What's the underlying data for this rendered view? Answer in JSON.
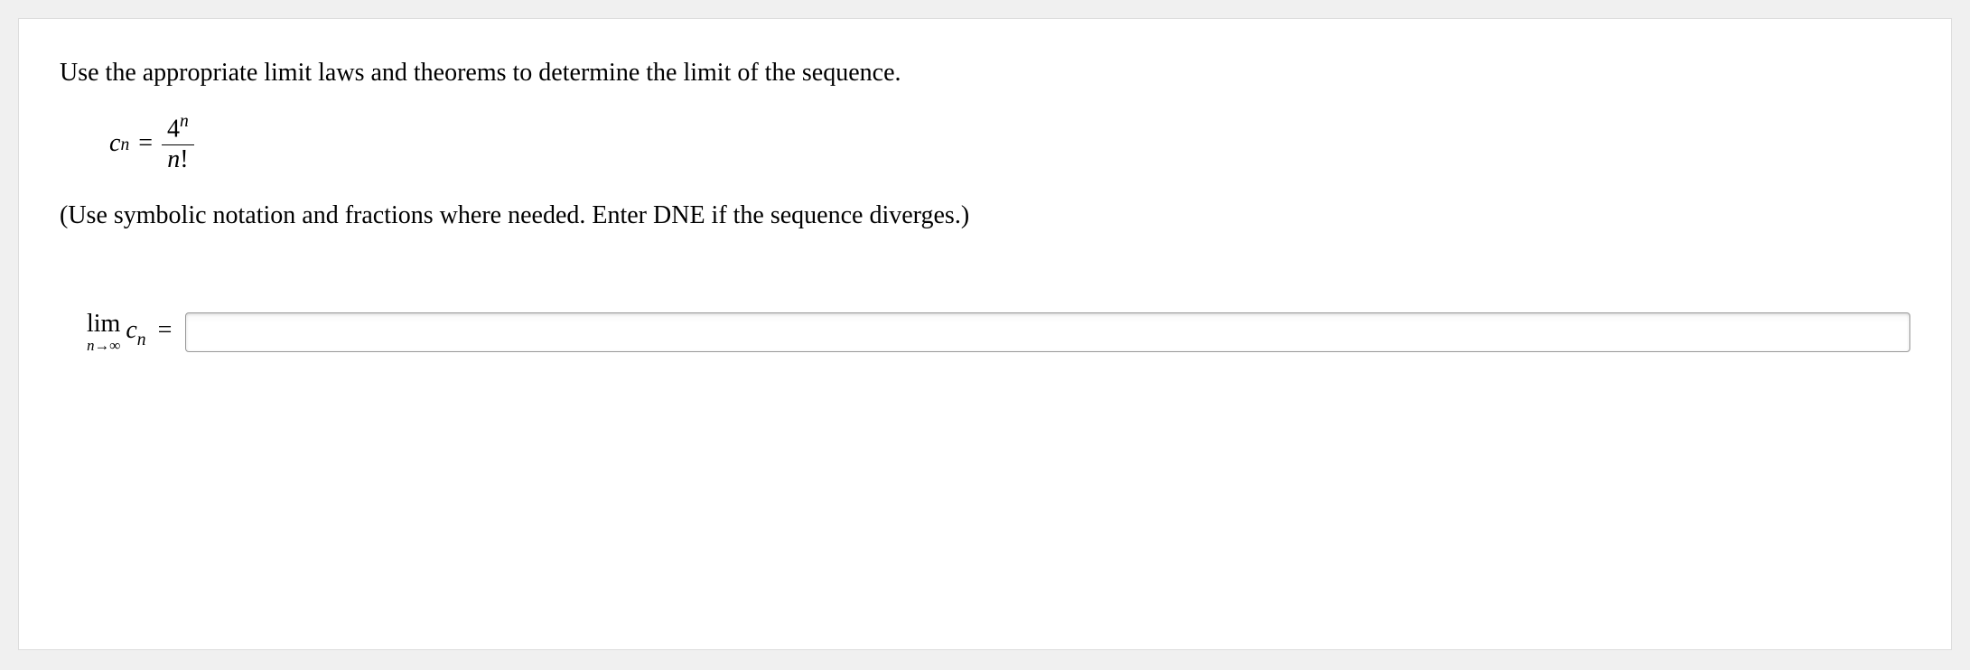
{
  "prompt": "Use the appropriate limit laws and theorems to determine the limit of the sequence.",
  "formula": {
    "lhs_var": "c",
    "lhs_sub": "n",
    "eq": "=",
    "num_base": "4",
    "num_exp": "n",
    "den_var": "n",
    "den_op": "!"
  },
  "hint": "(Use symbolic notation and fractions where needed. Enter DNE if the sequence diverges.)",
  "answer": {
    "lim_label": "lim",
    "lim_sub": "n→∞",
    "var": "c",
    "var_sub": "n",
    "eq": "=",
    "value": ""
  }
}
